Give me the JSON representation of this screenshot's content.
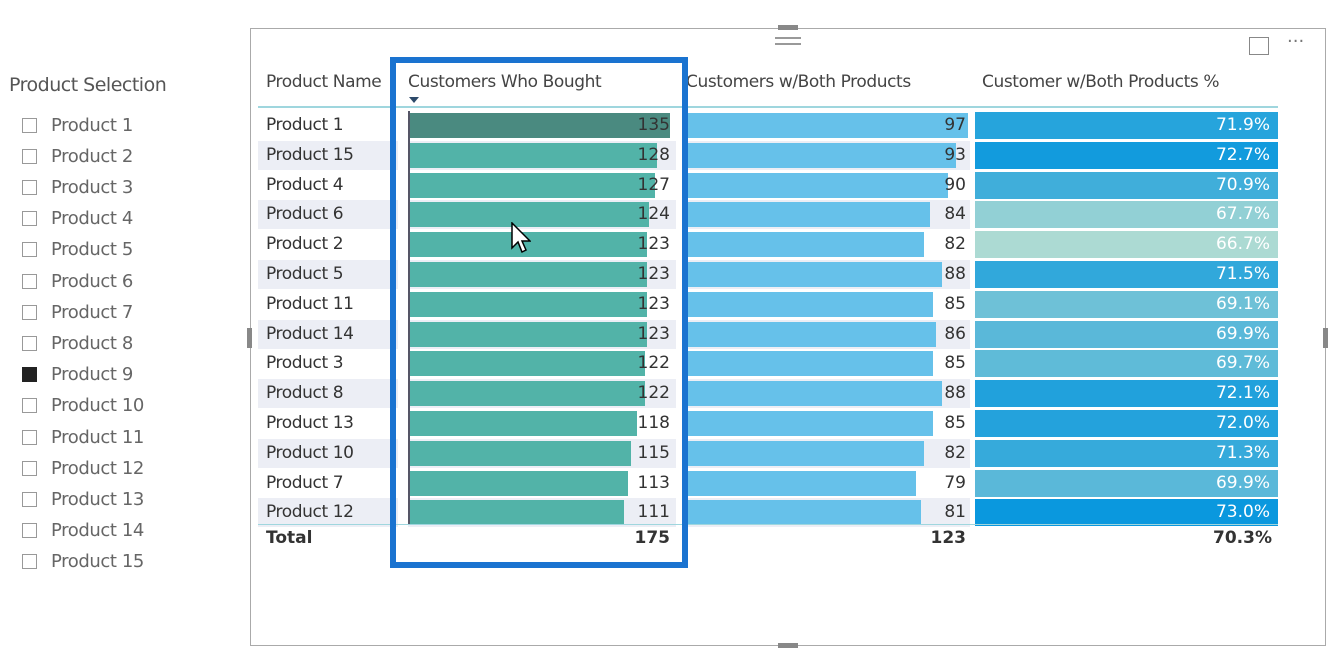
{
  "slicer": {
    "title": "Product Selection",
    "items": [
      {
        "label": "Product 1",
        "checked": false
      },
      {
        "label": "Product 2",
        "checked": false
      },
      {
        "label": "Product 3",
        "checked": false
      },
      {
        "label": "Product 4",
        "checked": false
      },
      {
        "label": "Product 5",
        "checked": false
      },
      {
        "label": "Product 6",
        "checked": false
      },
      {
        "label": "Product 7",
        "checked": false
      },
      {
        "label": "Product 8",
        "checked": false
      },
      {
        "label": "Product 9",
        "checked": true
      },
      {
        "label": "Product 10",
        "checked": false
      },
      {
        "label": "Product 11",
        "checked": false
      },
      {
        "label": "Product 12",
        "checked": false
      },
      {
        "label": "Product 13",
        "checked": false
      },
      {
        "label": "Product 14",
        "checked": false
      },
      {
        "label": "Product 15",
        "checked": false
      }
    ]
  },
  "visual": {
    "focus_icon": "focus-mode-icon",
    "more_icon": "more-options-icon"
  },
  "table": {
    "columns": [
      "Product Name",
      "Customers Who Bought",
      "Customers w/Both Products",
      "Customer w/Both Products %"
    ],
    "sorted_column": "Customers Who Bought",
    "sort_direction": "descending",
    "rows": [
      {
        "name": "Product 1",
        "bought": 135,
        "both": 97,
        "pct": "71.9%",
        "pct_value": 71.9
      },
      {
        "name": "Product 15",
        "bought": 128,
        "both": 93,
        "pct": "72.7%",
        "pct_value": 72.7
      },
      {
        "name": "Product 4",
        "bought": 127,
        "both": 90,
        "pct": "70.9%",
        "pct_value": 70.9
      },
      {
        "name": "Product 6",
        "bought": 124,
        "both": 84,
        "pct": "67.7%",
        "pct_value": 67.7
      },
      {
        "name": "Product 2",
        "bought": 123,
        "both": 82,
        "pct": "66.7%",
        "pct_value": 66.7
      },
      {
        "name": "Product 5",
        "bought": 123,
        "both": 88,
        "pct": "71.5%",
        "pct_value": 71.5
      },
      {
        "name": "Product 11",
        "bought": 123,
        "both": 85,
        "pct": "69.1%",
        "pct_value": 69.1
      },
      {
        "name": "Product 14",
        "bought": 123,
        "both": 86,
        "pct": "69.9%",
        "pct_value": 69.9
      },
      {
        "name": "Product 3",
        "bought": 122,
        "both": 85,
        "pct": "69.7%",
        "pct_value": 69.7
      },
      {
        "name": "Product 8",
        "bought": 122,
        "both": 88,
        "pct": "72.1%",
        "pct_value": 72.1
      },
      {
        "name": "Product 13",
        "bought": 118,
        "both": 85,
        "pct": "72.0%",
        "pct_value": 72.0
      },
      {
        "name": "Product 10",
        "bought": 115,
        "both": 82,
        "pct": "71.3%",
        "pct_value": 71.3
      },
      {
        "name": "Product 7",
        "bought": 113,
        "both": 79,
        "pct": "69.9%",
        "pct_value": 69.9
      },
      {
        "name": "Product 12",
        "bought": 111,
        "both": 81,
        "pct": "73.0%",
        "pct_value": 73.0
      }
    ],
    "total": {
      "label": "Total",
      "bought": "175",
      "both": "123",
      "pct": "70.3%"
    }
  },
  "colors": {
    "bought_bar": "#52b3a8",
    "bought_bar_selected": "#4a8a80",
    "both_bar": "#66c1ea",
    "pct_low": "#acdad3",
    "pct_high": "#0a98de",
    "highlight": "#1a73d0"
  }
}
